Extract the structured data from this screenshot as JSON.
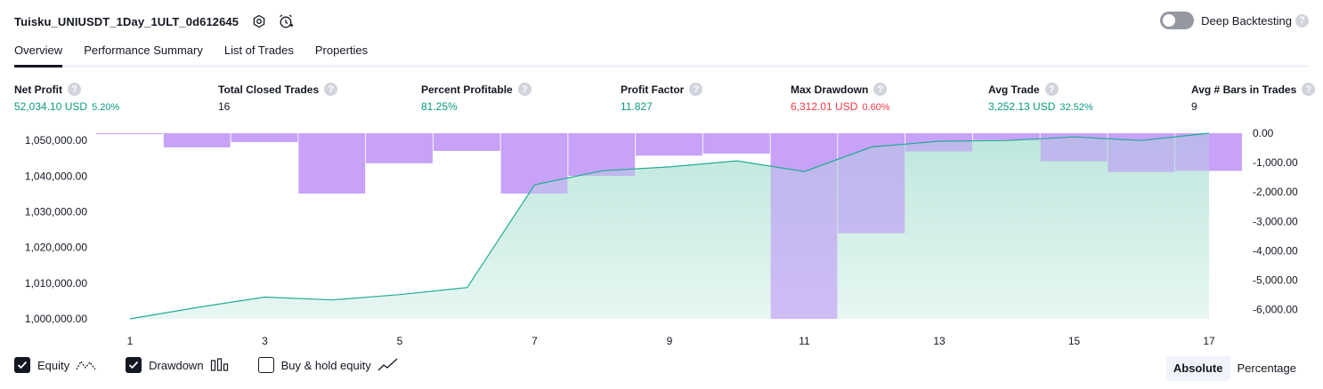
{
  "header": {
    "title": "Tuisku_UNIUSDT_1Day_1ULT_0d612645",
    "deep_backtesting_label": "Deep Backtesting",
    "help_glyph": "?"
  },
  "tabs": [
    {
      "label": "Overview",
      "active": true
    },
    {
      "label": "Performance Summary",
      "active": false
    },
    {
      "label": "List of Trades",
      "active": false
    },
    {
      "label": "Properties",
      "active": false
    }
  ],
  "metrics": [
    {
      "label": "Net Profit",
      "value": "52,034.10 USD",
      "sub": "5.20%",
      "color": "green"
    },
    {
      "label": "Total Closed Trades",
      "value": "16",
      "sub": "",
      "color": "dark"
    },
    {
      "label": "Percent Profitable",
      "value": "81.25%",
      "sub": "",
      "color": "green"
    },
    {
      "label": "Profit Factor",
      "value": "11.827",
      "sub": "",
      "color": "green"
    },
    {
      "label": "Max Drawdown",
      "value": "6,312.01 USD",
      "sub": "0.60%",
      "color": "red"
    },
    {
      "label": "Avg Trade",
      "value": "3,252.13 USD",
      "sub": "32.52%",
      "color": "green"
    },
    {
      "label": "Avg # Bars in Trades",
      "value": "9",
      "sub": "",
      "color": "dark"
    }
  ],
  "chart_data": {
    "type": "line",
    "x": [
      1,
      2,
      3,
      4,
      5,
      6,
      7,
      8,
      9,
      10,
      11,
      12,
      13,
      14,
      15,
      16,
      17
    ],
    "x_ticks": [
      "1",
      "3",
      "5",
      "7",
      "9",
      "11",
      "13",
      "15",
      "17"
    ],
    "series": [
      {
        "name": "Equity",
        "type": "area",
        "axis": "left",
        "values": [
          1000000,
          1003200,
          1006100,
          1005300,
          1006800,
          1008800,
          1037600,
          1041500,
          1042600,
          1044300,
          1041300,
          1048200,
          1049800,
          1050000,
          1051000,
          1050000,
          1052034
        ]
      },
      {
        "name": "Drawdown",
        "type": "bar",
        "axis": "right",
        "values": [
          -30,
          -480,
          -300,
          -2050,
          -1020,
          -600,
          -2050,
          -1450,
          -760,
          -690,
          -6312,
          -3400,
          -620,
          -230,
          -950,
          -1320,
          -1280
        ]
      }
    ],
    "y_left": {
      "ticks": [
        "1,000,000.00",
        "1,010,000.00",
        "1,020,000.00",
        "1,030,000.00",
        "1,040,000.00",
        "1,050,000.00"
      ],
      "range": [
        1000000,
        1052034
      ]
    },
    "y_right": {
      "ticks": [
        "0.00",
        "-1,000.00",
        "-2,000.00",
        "-3,000.00",
        "-4,000.00",
        "-5,000.00",
        "-6,000.00"
      ],
      "range": [
        -6312,
        0
      ]
    },
    "colors": {
      "equity_line": "#22ab94",
      "equity_fill": "#b5e3d8",
      "drawdown": "#c7a3f8",
      "axis_text": "#131722"
    },
    "grid": false,
    "legend": "bottom-left"
  },
  "legend": {
    "equity": {
      "label": "Equity",
      "checked": true
    },
    "drawdown": {
      "label": "Drawdown",
      "checked": true
    },
    "buyhold": {
      "label": "Buy & hold equity",
      "checked": false
    }
  },
  "mode": {
    "absolute": "Absolute",
    "percentage": "Percentage",
    "selected": "Absolute"
  }
}
